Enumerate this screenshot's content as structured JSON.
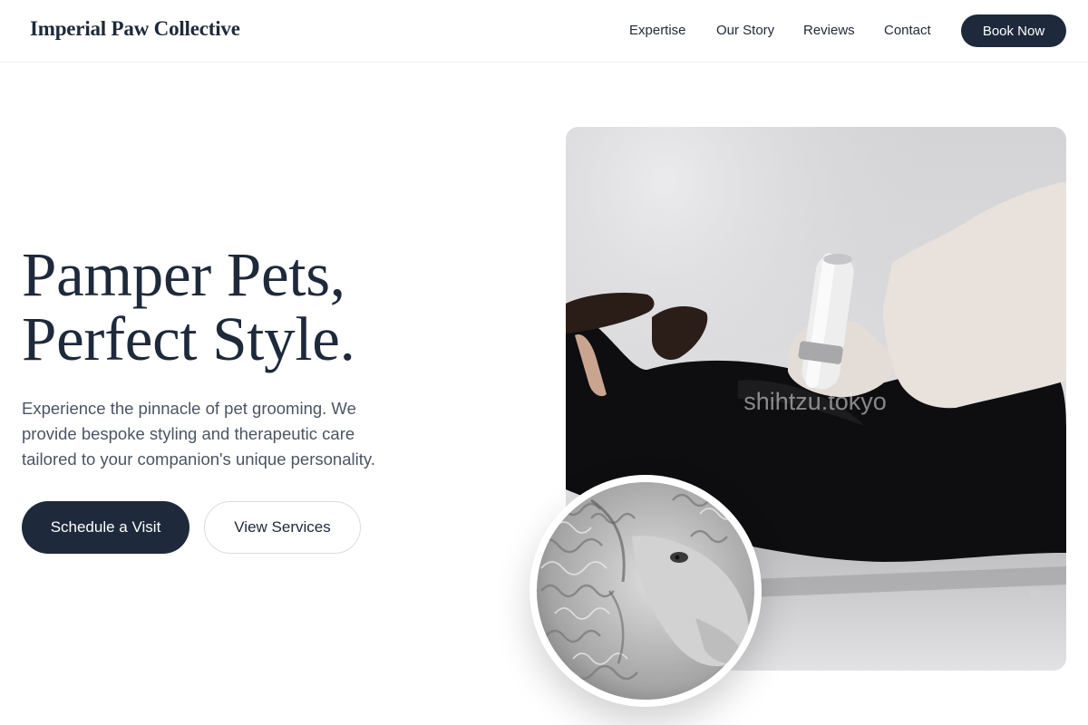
{
  "header": {
    "brand": "Imperial Paw Collective",
    "nav": [
      "Expertise",
      "Our Story",
      "Reviews",
      "Contact"
    ],
    "cta": "Book Now"
  },
  "hero": {
    "headline_line1": "Pamper Pets,",
    "headline_line2": "Perfect Style.",
    "description": "Experience the pinnacle of pet grooming. We provide bespoke styling and therapeutic care tailored to your companion's unique personality.",
    "primary_button": "Schedule a Visit",
    "secondary_button": "View Services",
    "photo_watermark": "shihtzu.tokyo"
  },
  "colors": {
    "navy": "#1e293b",
    "text_muted": "#4b5563"
  }
}
